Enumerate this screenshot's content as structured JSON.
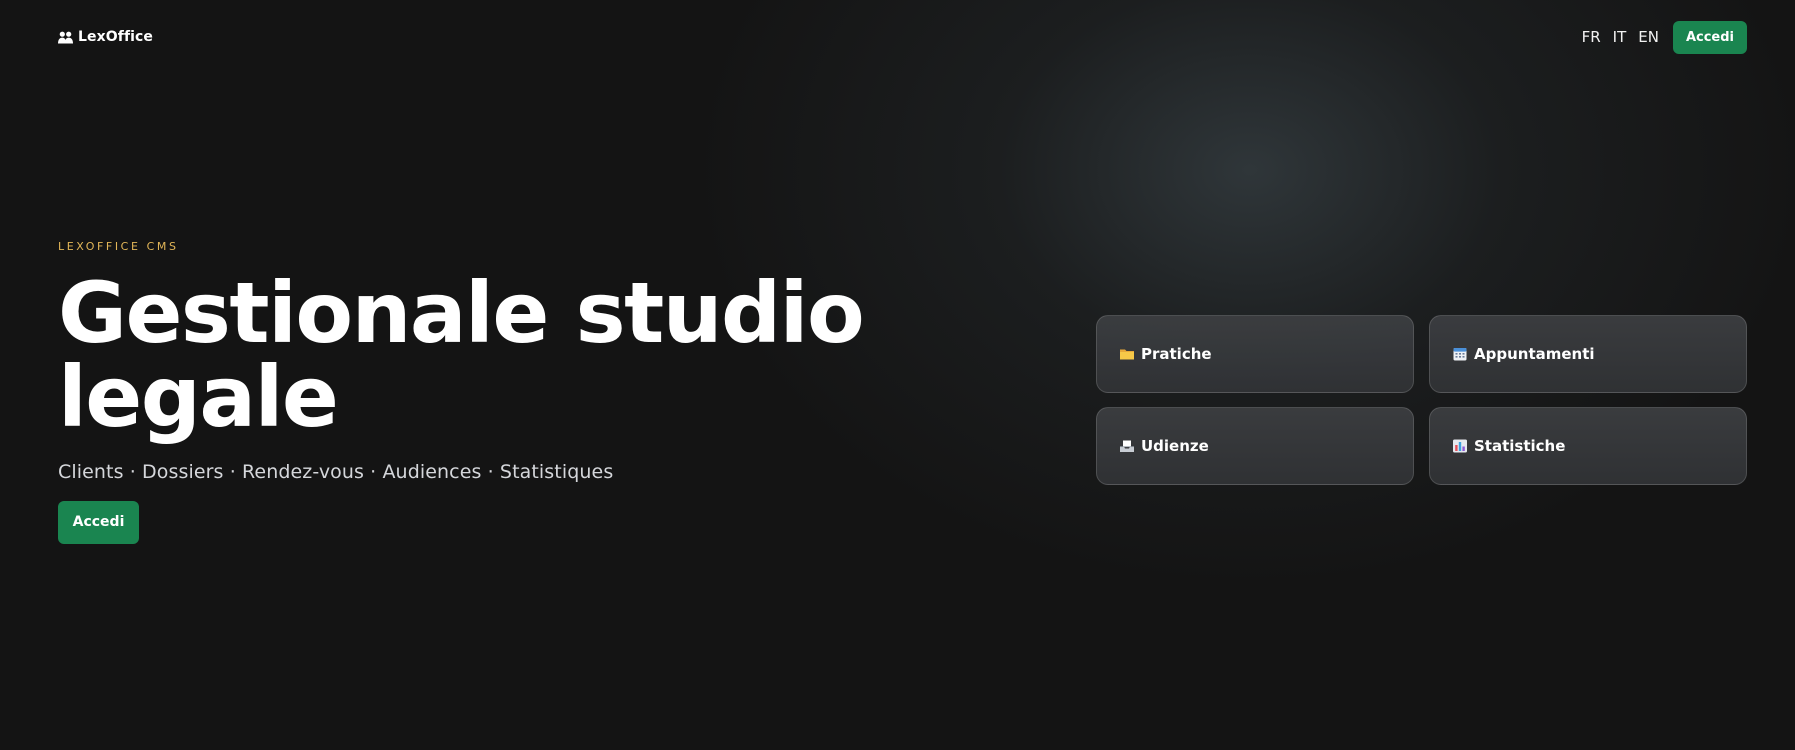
{
  "header": {
    "brand": "LexOffice",
    "brand_icon": "people-icon",
    "languages": [
      "FR",
      "IT",
      "EN"
    ],
    "login_label": "Accedi"
  },
  "hero": {
    "eyebrow": "LEXOFFICE CMS",
    "title": "Gestionale studio legale",
    "subtitle": "Clients · Dossiers · Rendez-vous · Audiences · Statistiques",
    "cta_label": "Accedi"
  },
  "features": [
    {
      "label": "Pratiche",
      "icon": "folder-icon"
    },
    {
      "label": "Appuntamenti",
      "icon": "calendar-icon"
    },
    {
      "label": "Udienze",
      "icon": "inbox-tray-icon"
    },
    {
      "label": "Statistiche",
      "icon": "bar-chart-icon"
    }
  ],
  "colors": {
    "background": "#141414",
    "accent_green": "#1a8550",
    "eyebrow_gold": "#e2b658"
  }
}
